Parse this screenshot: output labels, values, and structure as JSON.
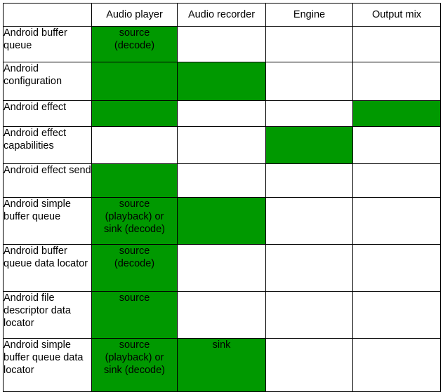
{
  "table": {
    "corner_label": "",
    "columns": [
      {
        "key": "feature",
        "label": ""
      },
      {
        "key": "audio_player",
        "label": "Audio player"
      },
      {
        "key": "audio_recorder",
        "label": "Audio recorder"
      },
      {
        "key": "engine",
        "label": "Engine"
      },
      {
        "key": "output_mix",
        "label": "Output mix"
      }
    ],
    "highlight_color": "#009900",
    "border_color": "#000000",
    "background_color": "#ffffff",
    "text_color": "#000000",
    "rows": [
      {
        "label": "Android buffer queue",
        "cells": [
          {
            "filled": true,
            "text": "source\n(decode)"
          },
          {
            "filled": false,
            "text": ""
          },
          {
            "filled": false,
            "text": ""
          },
          {
            "filled": false,
            "text": ""
          }
        ]
      },
      {
        "label": "Android configuration",
        "cells": [
          {
            "filled": true,
            "text": ""
          },
          {
            "filled": true,
            "text": ""
          },
          {
            "filled": false,
            "text": ""
          },
          {
            "filled": false,
            "text": ""
          }
        ]
      },
      {
        "label": "Android effect",
        "cells": [
          {
            "filled": true,
            "text": ""
          },
          {
            "filled": false,
            "text": ""
          },
          {
            "filled": false,
            "text": ""
          },
          {
            "filled": true,
            "text": ""
          }
        ]
      },
      {
        "label": "Android effect capabilities",
        "cells": [
          {
            "filled": false,
            "text": ""
          },
          {
            "filled": false,
            "text": ""
          },
          {
            "filled": true,
            "text": ""
          },
          {
            "filled": false,
            "text": ""
          }
        ]
      },
      {
        "label": "Android effect send",
        "cells": [
          {
            "filled": true,
            "text": ""
          },
          {
            "filled": false,
            "text": ""
          },
          {
            "filled": false,
            "text": ""
          },
          {
            "filled": false,
            "text": ""
          }
        ]
      },
      {
        "label": "Android simple buffer queue",
        "cells": [
          {
            "filled": true,
            "text": "source\n(playback) or\nsink (decode)"
          },
          {
            "filled": true,
            "text": ""
          },
          {
            "filled": false,
            "text": ""
          },
          {
            "filled": false,
            "text": ""
          }
        ]
      },
      {
        "label": "Android buffer queue data locator",
        "cells": [
          {
            "filled": true,
            "text": "source\n(decode)"
          },
          {
            "filled": false,
            "text": ""
          },
          {
            "filled": false,
            "text": ""
          },
          {
            "filled": false,
            "text": ""
          }
        ]
      },
      {
        "label": "Android file descriptor data locator",
        "cells": [
          {
            "filled": true,
            "text": "source"
          },
          {
            "filled": false,
            "text": ""
          },
          {
            "filled": false,
            "text": ""
          },
          {
            "filled": false,
            "text": ""
          }
        ]
      },
      {
        "label": "Android simple buffer queue data locator",
        "cells": [
          {
            "filled": true,
            "text": "source\n(playback) or\nsink (decode)"
          },
          {
            "filled": true,
            "text": "sink"
          },
          {
            "filled": false,
            "text": ""
          },
          {
            "filled": false,
            "text": ""
          }
        ]
      }
    ]
  }
}
